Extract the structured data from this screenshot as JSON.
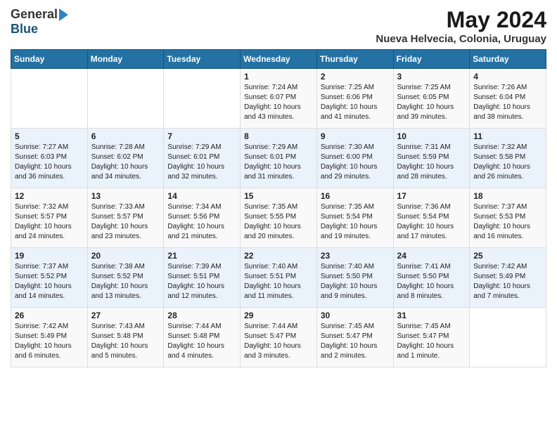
{
  "logo": {
    "general": "General",
    "blue": "Blue"
  },
  "header": {
    "month": "May 2024",
    "location": "Nueva Helvecia, Colonia, Uruguay"
  },
  "days_of_week": [
    "Sunday",
    "Monday",
    "Tuesday",
    "Wednesday",
    "Thursday",
    "Friday",
    "Saturday"
  ],
  "weeks": [
    [
      {
        "day": "",
        "content": ""
      },
      {
        "day": "",
        "content": ""
      },
      {
        "day": "",
        "content": ""
      },
      {
        "day": "1",
        "content": "Sunrise: 7:24 AM\nSunset: 6:07 PM\nDaylight: 10 hours\nand 43 minutes."
      },
      {
        "day": "2",
        "content": "Sunrise: 7:25 AM\nSunset: 6:06 PM\nDaylight: 10 hours\nand 41 minutes."
      },
      {
        "day": "3",
        "content": "Sunrise: 7:25 AM\nSunset: 6:05 PM\nDaylight: 10 hours\nand 39 minutes."
      },
      {
        "day": "4",
        "content": "Sunrise: 7:26 AM\nSunset: 6:04 PM\nDaylight: 10 hours\nand 38 minutes."
      }
    ],
    [
      {
        "day": "5",
        "content": "Sunrise: 7:27 AM\nSunset: 6:03 PM\nDaylight: 10 hours\nand 36 minutes."
      },
      {
        "day": "6",
        "content": "Sunrise: 7:28 AM\nSunset: 6:02 PM\nDaylight: 10 hours\nand 34 minutes."
      },
      {
        "day": "7",
        "content": "Sunrise: 7:29 AM\nSunset: 6:01 PM\nDaylight: 10 hours\nand 32 minutes."
      },
      {
        "day": "8",
        "content": "Sunrise: 7:29 AM\nSunset: 6:01 PM\nDaylight: 10 hours\nand 31 minutes."
      },
      {
        "day": "9",
        "content": "Sunrise: 7:30 AM\nSunset: 6:00 PM\nDaylight: 10 hours\nand 29 minutes."
      },
      {
        "day": "10",
        "content": "Sunrise: 7:31 AM\nSunset: 5:59 PM\nDaylight: 10 hours\nand 28 minutes."
      },
      {
        "day": "11",
        "content": "Sunrise: 7:32 AM\nSunset: 5:58 PM\nDaylight: 10 hours\nand 26 minutes."
      }
    ],
    [
      {
        "day": "12",
        "content": "Sunrise: 7:32 AM\nSunset: 5:57 PM\nDaylight: 10 hours\nand 24 minutes."
      },
      {
        "day": "13",
        "content": "Sunrise: 7:33 AM\nSunset: 5:57 PM\nDaylight: 10 hours\nand 23 minutes."
      },
      {
        "day": "14",
        "content": "Sunrise: 7:34 AM\nSunset: 5:56 PM\nDaylight: 10 hours\nand 21 minutes."
      },
      {
        "day": "15",
        "content": "Sunrise: 7:35 AM\nSunset: 5:55 PM\nDaylight: 10 hours\nand 20 minutes."
      },
      {
        "day": "16",
        "content": "Sunrise: 7:35 AM\nSunset: 5:54 PM\nDaylight: 10 hours\nand 19 minutes."
      },
      {
        "day": "17",
        "content": "Sunrise: 7:36 AM\nSunset: 5:54 PM\nDaylight: 10 hours\nand 17 minutes."
      },
      {
        "day": "18",
        "content": "Sunrise: 7:37 AM\nSunset: 5:53 PM\nDaylight: 10 hours\nand 16 minutes."
      }
    ],
    [
      {
        "day": "19",
        "content": "Sunrise: 7:37 AM\nSunset: 5:52 PM\nDaylight: 10 hours\nand 14 minutes."
      },
      {
        "day": "20",
        "content": "Sunrise: 7:38 AM\nSunset: 5:52 PM\nDaylight: 10 hours\nand 13 minutes."
      },
      {
        "day": "21",
        "content": "Sunrise: 7:39 AM\nSunset: 5:51 PM\nDaylight: 10 hours\nand 12 minutes."
      },
      {
        "day": "22",
        "content": "Sunrise: 7:40 AM\nSunset: 5:51 PM\nDaylight: 10 hours\nand 11 minutes."
      },
      {
        "day": "23",
        "content": "Sunrise: 7:40 AM\nSunset: 5:50 PM\nDaylight: 10 hours\nand 9 minutes."
      },
      {
        "day": "24",
        "content": "Sunrise: 7:41 AM\nSunset: 5:50 PM\nDaylight: 10 hours\nand 8 minutes."
      },
      {
        "day": "25",
        "content": "Sunrise: 7:42 AM\nSunset: 5:49 PM\nDaylight: 10 hours\nand 7 minutes."
      }
    ],
    [
      {
        "day": "26",
        "content": "Sunrise: 7:42 AM\nSunset: 5:49 PM\nDaylight: 10 hours\nand 6 minutes."
      },
      {
        "day": "27",
        "content": "Sunrise: 7:43 AM\nSunset: 5:48 PM\nDaylight: 10 hours\nand 5 minutes."
      },
      {
        "day": "28",
        "content": "Sunrise: 7:44 AM\nSunset: 5:48 PM\nDaylight: 10 hours\nand 4 minutes."
      },
      {
        "day": "29",
        "content": "Sunrise: 7:44 AM\nSunset: 5:47 PM\nDaylight: 10 hours\nand 3 minutes."
      },
      {
        "day": "30",
        "content": "Sunrise: 7:45 AM\nSunset: 5:47 PM\nDaylight: 10 hours\nand 2 minutes."
      },
      {
        "day": "31",
        "content": "Sunrise: 7:45 AM\nSunset: 5:47 PM\nDaylight: 10 hours\nand 1 minute."
      },
      {
        "day": "",
        "content": ""
      }
    ]
  ]
}
